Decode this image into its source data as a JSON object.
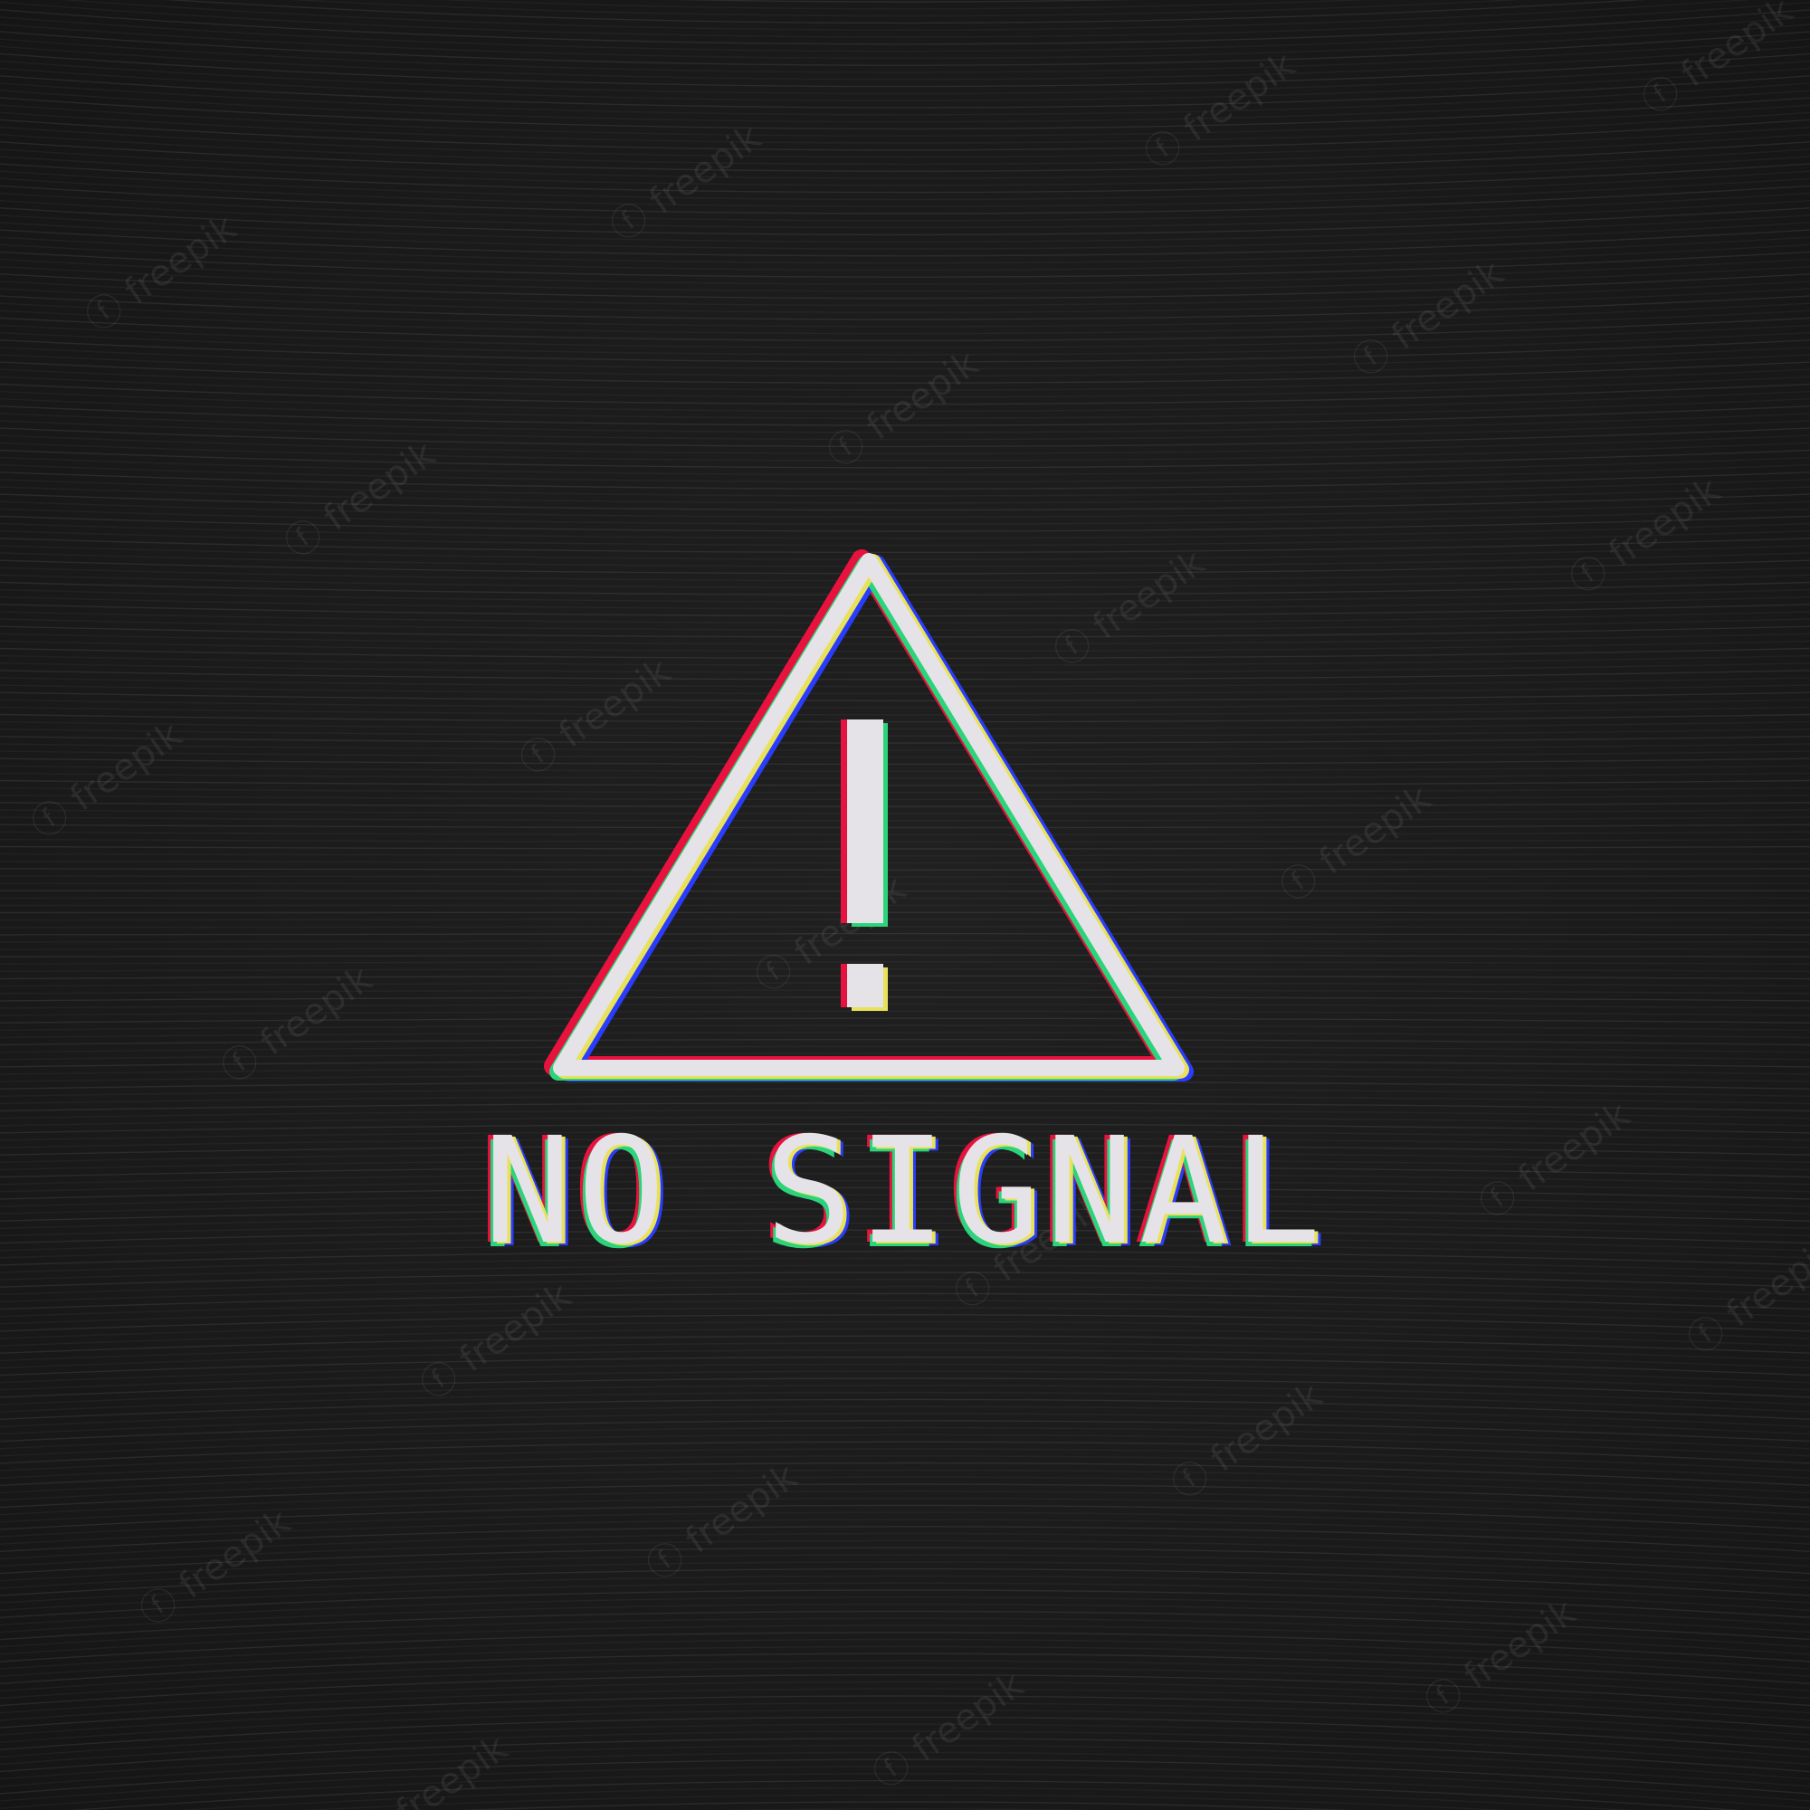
{
  "screen": {
    "message": "NO SIGNAL",
    "icon": "warning-triangle-icon",
    "watermark_text": "freepik"
  },
  "colors": {
    "background": "#1b1b1b",
    "foreground": "#e6e3e8",
    "glitch_red": "#e8123f",
    "glitch_blue": "#2a3cff",
    "glitch_green": "#2bd47a",
    "glitch_yellow": "#e8e25a"
  }
}
